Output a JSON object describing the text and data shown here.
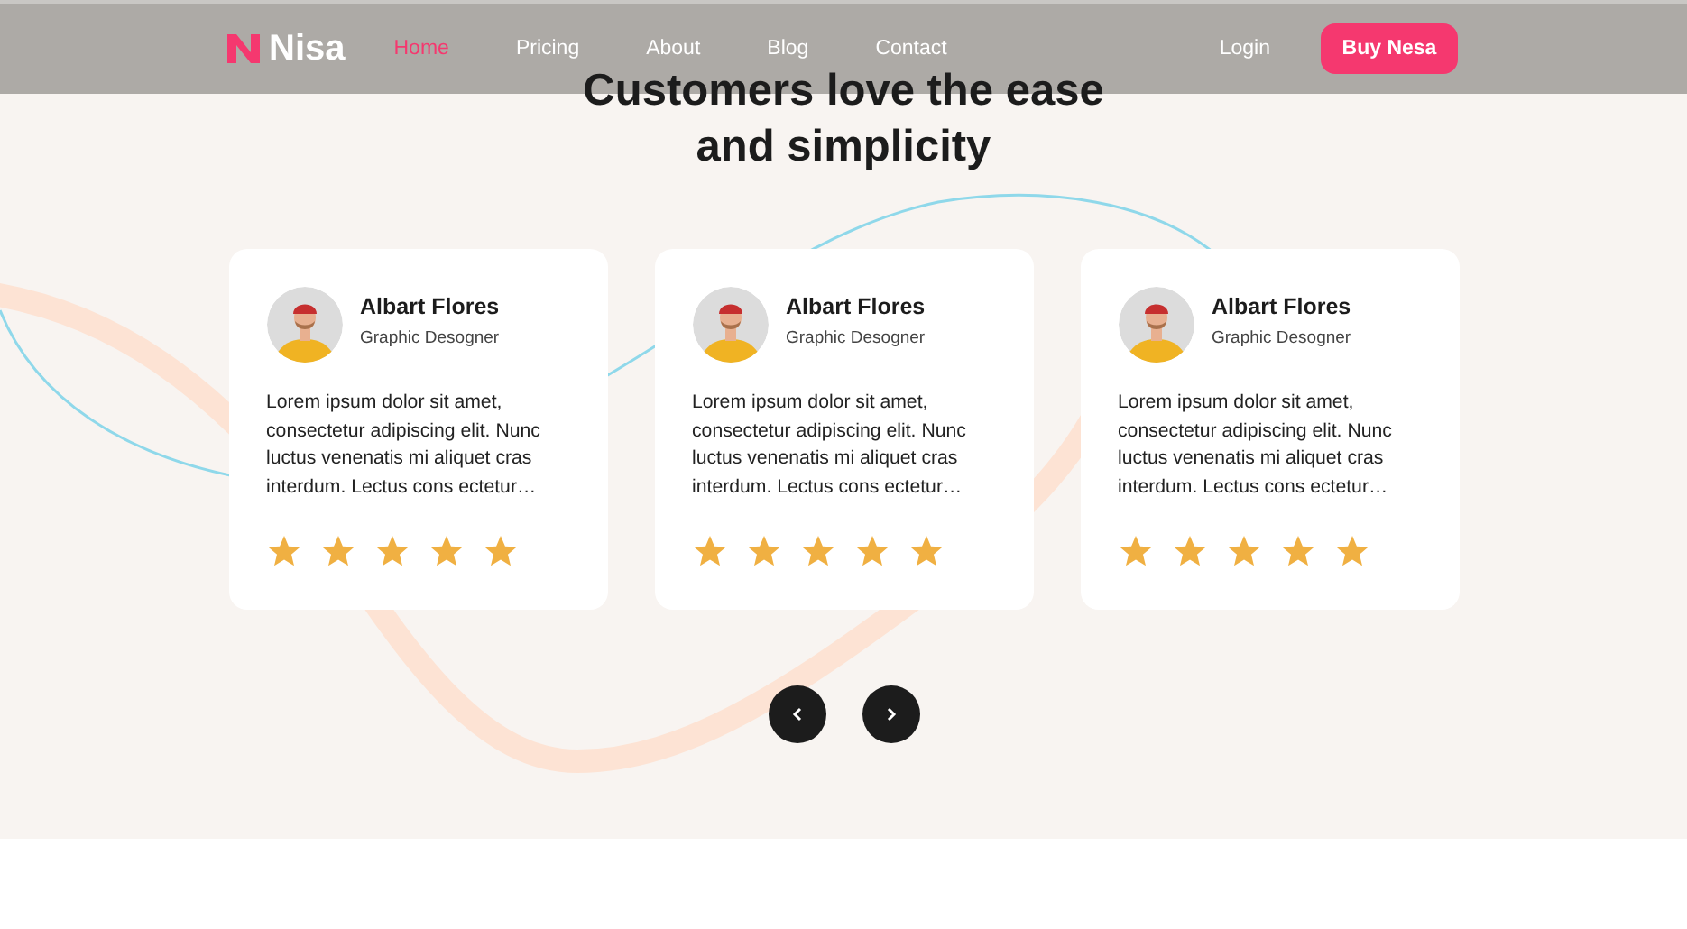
{
  "header": {
    "logo": "Nisa",
    "nav": [
      {
        "label": "Home",
        "selected": true
      },
      {
        "label": "Pricing",
        "selected": false
      },
      {
        "label": "About",
        "selected": false
      },
      {
        "label": "Blog",
        "selected": false
      },
      {
        "label": "Contact",
        "selected": false
      }
    ],
    "login": "Login",
    "cta": "Buy Nesa"
  },
  "title": "Customers love the ease and simplicity",
  "cards": [
    {
      "name": "Albart Flores",
      "role": "Graphic Desogner",
      "text": "Lorem ipsum dolor sit amet, consectetur adipiscing elit. Nunc luctus venenatis mi aliquet cras interdum. Lectus cons ectetur…",
      "stars": 5
    },
    {
      "name": "Albart Flores",
      "role": "Graphic Desogner",
      "text": "Lorem ipsum dolor sit amet, consectetur adipiscing elit. Nunc luctus venenatis mi aliquet cras interdum. Lectus cons ectetur…",
      "stars": 5
    },
    {
      "name": "Albart Flores",
      "role": "Graphic Desogner",
      "text": "Lorem ipsum dolor sit amet, consectetur adipiscing elit. Nunc luctus venenatis mi aliquet cras interdum. Lectus cons ectetur…",
      "stars": 5
    }
  ]
}
